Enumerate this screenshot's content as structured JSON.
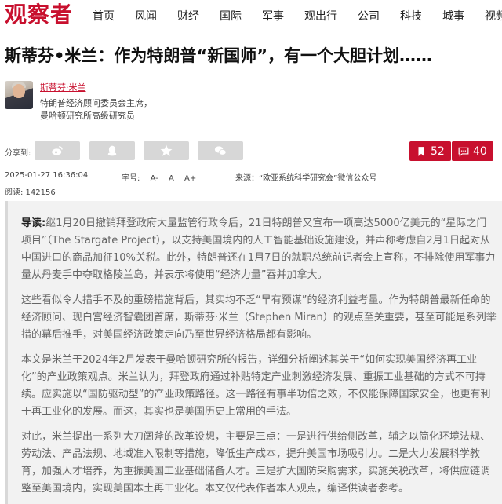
{
  "header": {
    "logo": "观察者",
    "nav": [
      "首页",
      "风闻",
      "财经",
      "国际",
      "军事",
      "观出行",
      "公司",
      "科技",
      "城事",
      "视频"
    ]
  },
  "article": {
    "title": "斯蒂芬•米兰：作为特朗普“新国师”，有一个大胆计划……",
    "author": {
      "name": "斯蒂芬·米兰",
      "description": "特朗普经济顾问委员会主席，曼哈顿研究所高级研究员"
    },
    "share": {
      "label": "分享到:",
      "icons": [
        "weibo-icon",
        "qq-icon",
        "qzone-star-icon",
        "wechat-icon"
      ],
      "bookmark_count": "52",
      "comment_count": "40"
    },
    "meta": {
      "datetime": "2025-01-27 16:36:04",
      "font_size_label": "字号:",
      "font_sizes": [
        "A-",
        "A",
        "A+"
      ],
      "source": "来源：“欧亚系统科学研究会”微信公众号",
      "reads": "阅读: 142156"
    },
    "lead_label": "导读:",
    "paragraphs": [
      "继1月20日撤销拜登政府大量监管行政令后，21日特朗普又宣布一项高达5000亿美元的“星际之门项目”（The Stargate Project），以支持美国境内的人工智能基础设施建设，并声称考虑自2月1日起对从中国进口的商品加征10%关税。此外，特朗普还在1月7日的就职总统前记者会上宣称，不排除使用军事力量从丹麦手中夺取格陵兰岛，并表示将使用“经济力量”吞并加拿大。",
      "这些看似令人措手不及的重磅措施背后，其实均不乏“早有预谋”的经济利益考量。作为特朗普最新任命的经济顾问、现白宫经济智囊团首席，斯蒂芬·米兰（Stephen Miran）的观点至关重要，甚至可能是系列举措的幕后推手，对美国经济政策走向乃至世界经济格局都有影响。",
      "本文是米兰于2024年2月发表于曼哈顿研究所的报告，详细分析阐述其关于“如何实现美国经济再工业化”的产业政策观点。米兰认为，拜登政府通过补贴特定产业刺激经济发展、重振工业基础的方式不可持续。应实施以“国防驱动型”的产业政策路径。这一路径有事半功倍之效，不仅能保障国家安全，也更有利于再工业化的发展。而这，其实也是美国历史上常用的手法。",
      "对此，米兰提出一系列大刀阔斧的改革设想，主要是三点：一是进行供给侧改革，辅之以简化环境法规、劳动法、产品法规、地域准入限制等措施，降低生产成本，提升美国市场吸引力。二是大力发展科学教育，加强人才培养，为重振美国工业基础储备人才。三是扩大国防采购需求，实施关税改革，将供应链调整至美国境内，实现美国本土再工业化。本文仅代表作者本人观点，编译供读者参考。"
    ]
  }
}
